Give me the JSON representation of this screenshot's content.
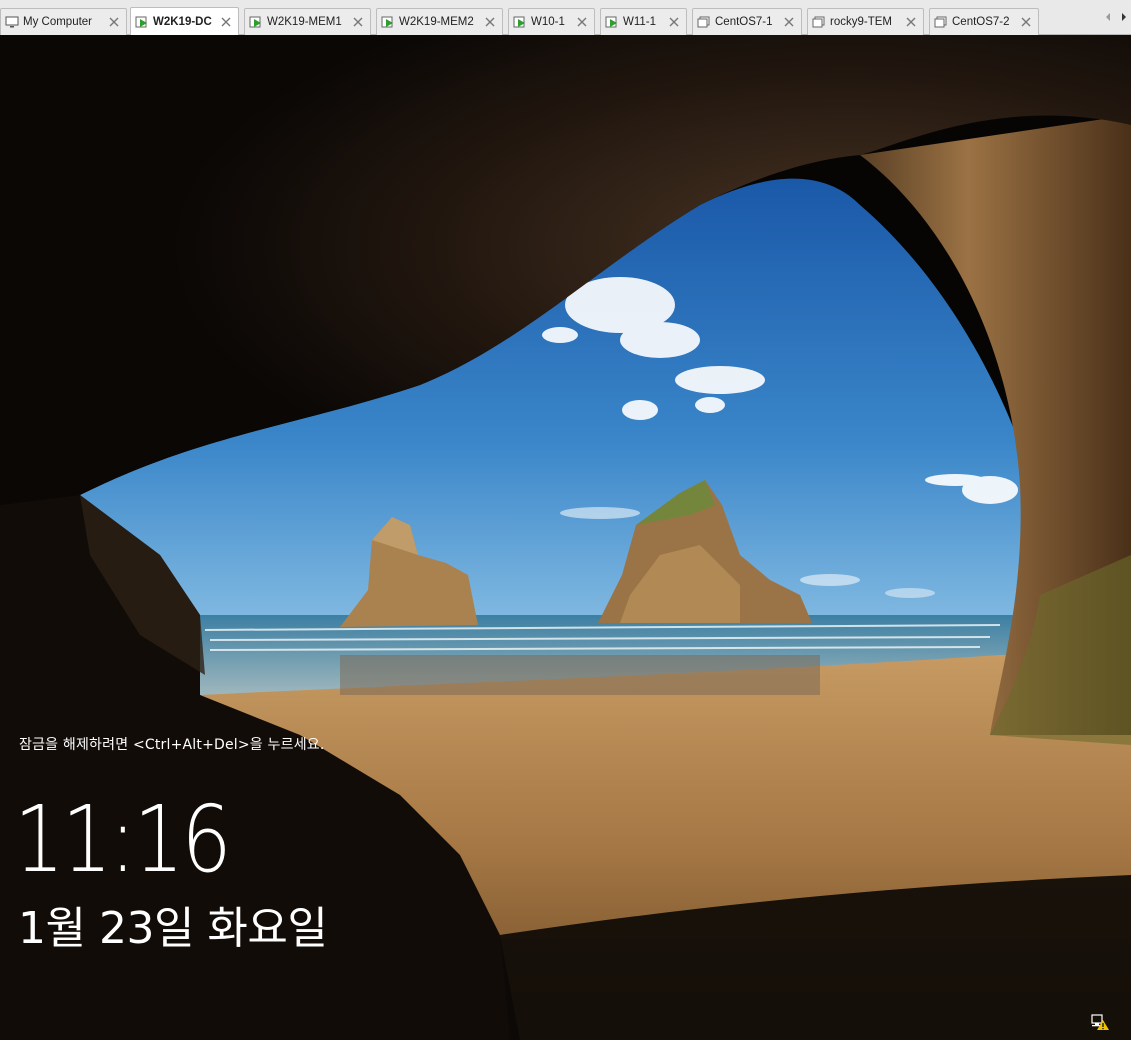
{
  "tabs": [
    {
      "label": "My Computer",
      "icon": "computer-icon",
      "active": false
    },
    {
      "label": "W2K19-DC",
      "icon": "vm-running-icon",
      "active": true
    },
    {
      "label": "W2K19-MEM1",
      "icon": "vm-running-icon",
      "active": false
    },
    {
      "label": "W2K19-MEM2",
      "icon": "vm-running-icon",
      "active": false
    },
    {
      "label": "W10-1",
      "icon": "vm-running-icon",
      "active": false
    },
    {
      "label": "W11-1",
      "icon": "vm-running-icon",
      "active": false
    },
    {
      "label": "CentOS7-1",
      "icon": "vm-icon",
      "active": false
    },
    {
      "label": "rocky9-TEM",
      "icon": "vm-icon",
      "active": false
    },
    {
      "label": "CentOS7-2",
      "icon": "vm-icon",
      "active": false
    }
  ],
  "lockscreen": {
    "hint": "잠금을 해제하려면 <Ctrl+Alt+Del>을 누르세요.",
    "time": "11:16",
    "date": "1월 23일 화요일",
    "network_icon": "network-warning-icon"
  },
  "colors": {
    "tab_bar": "#e9e9e9",
    "active_tab": "#ffffff",
    "running_green": "#2e9e2e",
    "sky": "#2f6fb5",
    "sand": "#b98a52"
  }
}
